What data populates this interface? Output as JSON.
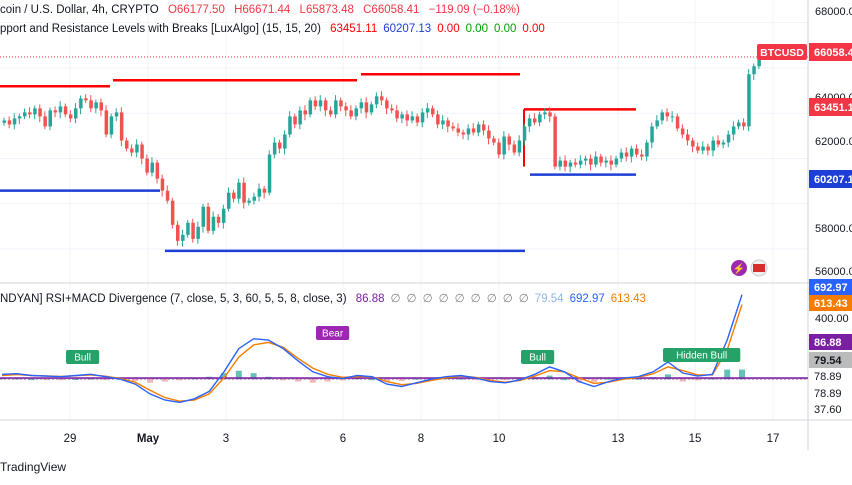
{
  "header": {
    "symbol_line": "coin / U.S. Dollar, 4h, CRYPTO",
    "ohlc": {
      "o": "O66177.50",
      "h": "H66671.44",
      "l": "L65873.48",
      "c": "C66058.41",
      "chg": "−119.09 (−0.18%)"
    },
    "indicator_line": "pport and Resistance Levels with Breaks [LuxAlgo] (15, 15, 20)",
    "indicator_values": [
      "63451.11",
      "60207.13",
      "0.00",
      "0.00",
      "0.00",
      "0.00"
    ],
    "indicator_colors": [
      "#ff0000",
      "#1e3fd6",
      "#ff0000",
      "#00a000",
      "#00a000",
      "#ff0000"
    ]
  },
  "sub_header": {
    "label": "NDYAN] RSI+MACD Divergence (7, close, 5, 3, 60, 5, 5, 8, close, 3)",
    "values": [
      "86.88",
      "∅",
      "∅",
      "∅",
      "∅",
      "∅",
      "∅",
      "∅",
      "∅",
      "∅",
      "79.54",
      "692.97",
      "613.43"
    ],
    "colors": [
      "#7b1fa2",
      "#888888",
      "#888888",
      "#888888",
      "#888888",
      "#888888",
      "#888888",
      "#888888",
      "#888888",
      "#888888",
      "#8fb8e8",
      "#2962ff",
      "#f57c00"
    ]
  },
  "price_axis": {
    "ticks": [
      "68000.00",
      "64000.00",
      "62000.00",
      "58000.00",
      "56000.00"
    ],
    "badges": [
      {
        "label": "BTCUSD",
        "value": "66058.41",
        "color": "#f23645"
      },
      {
        "label": "",
        "value": "63451.11",
        "color": "#f23645"
      },
      {
        "label": "",
        "value": "60207.13",
        "color": "#1e3fd6"
      }
    ]
  },
  "osc_axis": {
    "ticks": [
      "400.00"
    ],
    "badges": [
      {
        "value": "692.97",
        "color": "#2962ff"
      },
      {
        "value": "613.43",
        "color": "#f57c00"
      },
      {
        "value": "86.88",
        "color": "#7b1fa2"
      },
      {
        "value": "79.54",
        "color": "#bbbbbb"
      },
      {
        "value": "78.89",
        "color": "#ffffff"
      },
      {
        "value": "78.89",
        "color": "#ffffff"
      },
      {
        "value": "37.60",
        "color": "#ffffff"
      }
    ]
  },
  "time_axis": [
    "29",
    "May",
    "3",
    "6",
    "8",
    "10",
    "13",
    "15",
    "17"
  ],
  "labels": {
    "bull": "Bull",
    "bear": "Bear",
    "hidden_bull": "Hidden Bull"
  },
  "brand": "TradingView",
  "colors": {
    "up": "#26a69a",
    "down": "#ef5350",
    "resistance": "#ff0000",
    "support": "#1e3fd6"
  },
  "chart_data": [
    {
      "type": "candlestick",
      "title": "coin / U.S. Dollar, 4h, CRYPTO",
      "ylim": [
        55200,
        68500
      ],
      "x_ticks": [
        "29",
        "May",
        "3",
        "6",
        "8",
        "10",
        "13",
        "15",
        "17"
      ],
      "closes": [
        62900,
        62700,
        63000,
        63100,
        63300,
        63200,
        63500,
        63100,
        62600,
        63400,
        63300,
        63600,
        63200,
        63000,
        63500,
        64000,
        63900,
        63500,
        63800,
        63400,
        62200,
        63100,
        63300,
        61900,
        61500,
        61300,
        61700,
        61000,
        60300,
        60800,
        60000,
        59400,
        58900,
        57700,
        56900,
        57200,
        57800,
        57000,
        57600,
        58600,
        57400,
        58100,
        57800,
        58500,
        59300,
        59000,
        59800,
        58800,
        58900,
        59100,
        59500,
        59300,
        61200,
        61800,
        61500,
        62200,
        63100,
        62700,
        63400,
        63200,
        63900,
        63600,
        63900,
        63400,
        63200,
        63900,
        63600,
        63400,
        63100,
        63500,
        63800,
        63300,
        63700,
        64100,
        63900,
        63500,
        63400,
        63000,
        63200,
        62900,
        63100,
        62800,
        63300,
        63500,
        63200,
        62700,
        62900,
        62600,
        62500,
        62300,
        62200,
        62500,
        62300,
        62700,
        62400,
        62000,
        61800,
        61200,
        62100,
        61700,
        61300,
        61900,
        62600,
        63000,
        62800,
        63200,
        63300,
        63100,
        60600,
        60900,
        60600,
        60800,
        60700,
        60900,
        61000,
        60700,
        61100,
        60800,
        60900,
        60700,
        61000,
        61300,
        61100,
        61500,
        61200,
        61100,
        61800,
        62600,
        62900,
        63300,
        63100,
        63100,
        62500,
        62200,
        61900,
        61600,
        61400,
        61600,
        61400,
        61900,
        61700,
        61800,
        62200,
        62600,
        62800,
        62600,
        65200,
        65600,
        66200,
        66100
      ],
      "series": [
        {
          "name": "Resistance",
          "values": [
            64600,
            64900,
            65200,
            63450
          ]
        },
        {
          "name": "Support",
          "values": [
            59400,
            56400,
            60200
          ]
        }
      ]
    },
    {
      "type": "line",
      "title": "RSI+MACD Divergence (7, close, 5, 3, 60, 5, 5, 8, close, 3)",
      "ylim": [
        -260,
        720
      ],
      "series": [
        {
          "name": "MACD",
          "values": [
            40,
            45,
            30,
            25,
            20,
            30,
            40,
            20,
            0,
            -40,
            -120,
            -170,
            -190,
            -160,
            -100,
            60,
            250,
            330,
            320,
            250,
            150,
            60,
            20,
            5,
            30,
            20,
            -40,
            -60,
            -30,
            0,
            20,
            30,
            10,
            -20,
            -30,
            -5,
            40,
            100,
            60,
            -20,
            -60,
            -20,
            10,
            20,
            60,
            140,
            50,
            25,
            40,
            320,
            690
          ]
        },
        {
          "name": "Signal",
          "values": [
            30,
            38,
            30,
            26,
            22,
            28,
            35,
            24,
            5,
            -25,
            -90,
            -150,
            -180,
            -170,
            -120,
            10,
            180,
            280,
            300,
            260,
            170,
            90,
            40,
            15,
            20,
            20,
            -20,
            -45,
            -35,
            -10,
            10,
            25,
            15,
            -10,
            -25,
            -10,
            25,
            70,
            60,
            10,
            -35,
            -25,
            0,
            15,
            45,
            100,
            70,
            35,
            35,
            240,
            610
          ]
        }
      ]
    }
  ]
}
